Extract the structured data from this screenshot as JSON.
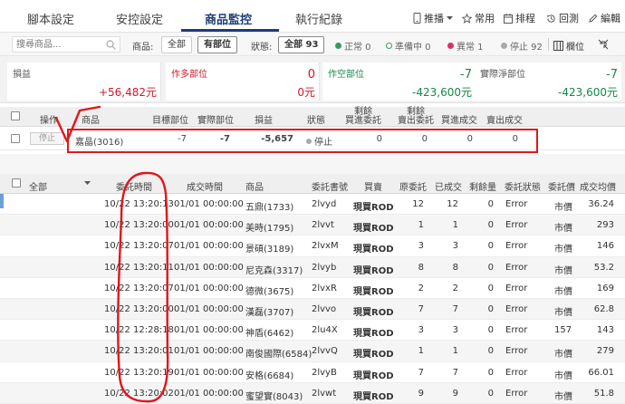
{
  "tabs": [
    {
      "label": "腳本設定"
    },
    {
      "label": "安控設定"
    },
    {
      "label": "商品監控"
    },
    {
      "label": "執行紀錄"
    }
  ],
  "toolbar": {
    "push": "推播",
    "favorite": "常用",
    "schedule": "排程",
    "backtest": "回測",
    "edit": "編輯"
  },
  "filter": {
    "search_placeholder": "搜尋商品...",
    "product_label": "商品:",
    "all": "全部",
    "has_position": "有部位",
    "status_label": "狀態:",
    "status_all": "全部 93",
    "normal": "正常 0",
    "ready": "準備中 0",
    "abnormal": "異常 1",
    "stopped": "停止 92",
    "columns": "欄位"
  },
  "summary": {
    "pnl_label": "損益",
    "pnl_value": "+56,482元",
    "long_label": "作多部位",
    "long_qty": "0",
    "long_amt": "0元",
    "short_label": "作空部位",
    "short_qty": "-7",
    "short_amt": "-423,600元",
    "net_label": "實際淨部位",
    "net_qty": "-7",
    "net_amt": "-423,600元"
  },
  "positions": {
    "headers": {
      "op": "操作",
      "product": "商品",
      "target": "目標部位",
      "actual": "實際部位",
      "pnl": "損益",
      "status": "狀態",
      "rem_buy": "剩餘\n買進委託",
      "rem_sell": "剩餘\n賣出委託",
      "buy_fill": "買進成交",
      "sell_fill": "賣出成交"
    },
    "row": {
      "btn": "停止",
      "product": "嘉晶(3016)",
      "target": "-7",
      "actual": "-7",
      "pnl": "-5,657",
      "status": "停止",
      "rem_buy": "0",
      "rem_sell": "0",
      "buy_fill": "0",
      "sell_fill": "0"
    }
  },
  "orders": {
    "headers": {
      "all": "全部",
      "order_time": "委託時間",
      "fill_time": "成交時間",
      "product": "商品",
      "order_no": "委託書號",
      "side": "買賣",
      "orig": "原委託",
      "filled": "已成交",
      "remain": "剩餘量",
      "status": "委託狀態",
      "price": "委託價",
      "avg": "成交均價"
    },
    "rows": [
      {
        "order_time": "10/22 13:20:13",
        "fill_time": "01/01 00:00:00",
        "product": "五鼎(1733)",
        "order_no": "2lvyd",
        "side": "現買ROD",
        "orig": "12",
        "filled": "12",
        "remain": "0",
        "status": "Error",
        "price": "市價",
        "avg": "36.24"
      },
      {
        "order_time": "10/22 13:20:00",
        "fill_time": "01/01 00:00:00",
        "product": "美時(1795)",
        "order_no": "2lvvt",
        "side": "現買ROD",
        "orig": "1",
        "filled": "1",
        "remain": "0",
        "status": "Error",
        "price": "市價",
        "avg": "293"
      },
      {
        "order_time": "10/22 13:20:07",
        "fill_time": "01/01 00:00:00",
        "product": "景碩(3189)",
        "order_no": "2lvxM",
        "side": "現買ROD",
        "orig": "3",
        "filled": "3",
        "remain": "0",
        "status": "Error",
        "price": "市價",
        "avg": "146"
      },
      {
        "order_time": "10/22 13:20:11",
        "fill_time": "01/01 00:00:00",
        "product": "尼克森(3317)",
        "order_no": "2lvyb",
        "side": "現買ROD",
        "orig": "8",
        "filled": "8",
        "remain": "0",
        "status": "Error",
        "price": "市價",
        "avg": "53.2"
      },
      {
        "order_time": "10/22 13:20:07",
        "fill_time": "01/01 00:00:00",
        "product": "德微(3675)",
        "order_no": "2lvxR",
        "side": "現買ROD",
        "orig": "2",
        "filled": "2",
        "remain": "0",
        "status": "Error",
        "price": "市價",
        "avg": "169"
      },
      {
        "order_time": "10/22 13:20:00",
        "fill_time": "01/01 00:00:00",
        "product": "漢磊(3707)",
        "order_no": "2lvvo",
        "side": "現買ROD",
        "orig": "7",
        "filled": "7",
        "remain": "0",
        "status": "Error",
        "price": "市價",
        "avg": "62.8"
      },
      {
        "order_time": "10/22 12:28:18",
        "fill_time": "01/01 00:00:00",
        "product": "神盾(6462)",
        "order_no": "2lu4X",
        "side": "現買ROD",
        "orig": "3",
        "filled": "3",
        "remain": "0",
        "status": "Error",
        "price": "157",
        "avg": "143"
      },
      {
        "order_time": "10/22 13:20:01",
        "fill_time": "01/01 00:00:00",
        "product": "南俊國際(6584)",
        "order_no": "2lvvQ",
        "side": "現買ROD",
        "orig": "1",
        "filled": "1",
        "remain": "0",
        "status": "Error",
        "price": "市價",
        "avg": "279"
      },
      {
        "order_time": "10/22 13:20:19",
        "fill_time": "01/01 00:00:00",
        "product": "安格(6684)",
        "order_no": "2lvyB",
        "side": "現買ROD",
        "orig": "7",
        "filled": "7",
        "remain": "0",
        "status": "Error",
        "price": "市價",
        "avg": "66.01"
      },
      {
        "order_time": "10/22 13:20:02",
        "fill_time": "01/01 00:00:00",
        "product": "蜜望實(8043)",
        "order_no": "2lvwt",
        "side": "現買ROD",
        "orig": "9",
        "filled": "9",
        "remain": "0",
        "status": "Error",
        "price": "市價",
        "avg": "51.8"
      }
    ]
  },
  "colors": {
    "accent": "#1d3d7a",
    "profit": "#d0192a",
    "loss": "#16864a",
    "side": "#c0145c",
    "annotation": "#e0161c"
  }
}
